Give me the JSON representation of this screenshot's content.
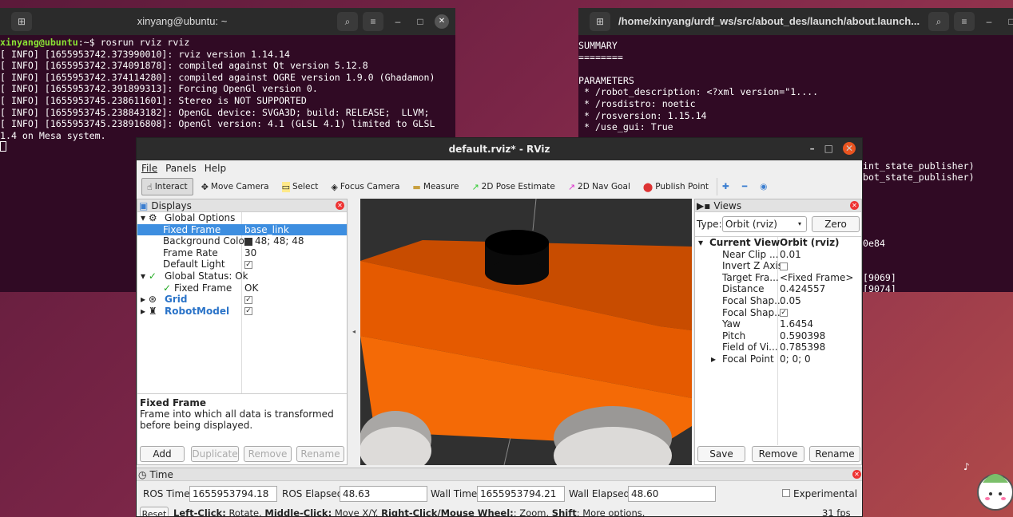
{
  "term1": {
    "title": "xinyang@ubuntu: ~",
    "prompt_user": "xinyang@ubuntu",
    "prompt_rest": ":~$ rosrun rviz rviz",
    "lines": [
      "[ INFO] [1655953742.373990010]: rviz version 1.14.14",
      "[ INFO] [1655953742.374091878]: compiled against Qt version 5.12.8",
      "[ INFO] [1655953742.374114280]: compiled against OGRE version 1.9.0 (Ghadamon)",
      "[ INFO] [1655953742.391899313]: Forcing OpenGl version 0.",
      "[ INFO] [1655953745.238611601]: Stereo is NOT SUPPORTED",
      "[ INFO] [1655953745.238843182]: OpenGL device: SVGA3D; build: RELEASE;  LLVM;",
      "[ INFO] [1655953745.238916808]: OpenGl version: 4.1 (GLSL 4.1) limited to GLSL",
      "1.4 on Mesa system."
    ]
  },
  "term2": {
    "title": "/home/xinyang/urdf_ws/src/about_des/launch/about.launch...",
    "lines": [
      "SUMMARY",
      "========",
      "",
      "PARAMETERS",
      " * /robot_description: <?xml version=\"1....",
      " * /rosdistro: noetic",
      " * /rosversion: 1.15.14",
      " * /use_gui: True"
    ],
    "right_fragments": [
      "int_state_publisher)",
      "bot_state_publisher)",
      "0e84",
      "[9069]",
      "[9074]"
    ]
  },
  "rviz": {
    "title": "default.rviz* - RViz",
    "menu": [
      "File",
      "Panels",
      "Help"
    ],
    "tools": [
      {
        "label": "Interact",
        "icon": "☝"
      },
      {
        "label": "Move Camera",
        "icon": "✥"
      },
      {
        "label": "Select",
        "icon": "▭"
      },
      {
        "label": "Focus Camera",
        "icon": "◈"
      },
      {
        "label": "Measure",
        "icon": "▬"
      },
      {
        "label": "2D Pose Estimate",
        "icon": "↗"
      },
      {
        "label": "2D Nav Goal",
        "icon": "↗"
      },
      {
        "label": "Publish Point",
        "icon": "⬤"
      }
    ],
    "displays": {
      "header": "Displays",
      "global_options": "Global Options",
      "fixed_frame_k": "Fixed Frame",
      "fixed_frame_v": "base_link",
      "bg_k": "Background Color",
      "bg_v": "48; 48; 48",
      "fr_k": "Frame Rate",
      "fr_v": "30",
      "dl_k": "Default Light",
      "gs_k": "Global Status: Ok",
      "ff2_k": "Fixed Frame",
      "ff2_v": "OK",
      "grid": "Grid",
      "robot": "RobotModel",
      "desc_title": "Fixed Frame",
      "desc_text": "Frame into which all data is transformed before being displayed.",
      "buttons": [
        "Add",
        "Duplicate",
        "Remove",
        "Rename"
      ]
    },
    "views": {
      "header": "Views",
      "type_label": "Type:",
      "type_value": "Orbit (rviz)",
      "zero": "Zero",
      "cv_k": "Current View",
      "cv_v": "Orbit (rviz)",
      "props": [
        {
          "k": "Near Clip ...",
          "v": "0.01"
        },
        {
          "k": "Invert Z Axis",
          "v": ""
        },
        {
          "k": "Target Fra...",
          "v": "<Fixed Frame>"
        },
        {
          "k": "Distance",
          "v": "0.424557"
        },
        {
          "k": "Focal Shap...",
          "v": "0.05"
        },
        {
          "k": "Focal Shap...",
          "v": ""
        },
        {
          "k": "Yaw",
          "v": "1.6454"
        },
        {
          "k": "Pitch",
          "v": "0.590398"
        },
        {
          "k": "Field of Vi...",
          "v": "0.785398"
        }
      ],
      "fp_k": "Focal Point",
      "fp_v": "0; 0; 0",
      "buttons": [
        "Save",
        "Remove",
        "Rename"
      ]
    },
    "time": {
      "header": "Time",
      "ros_time_l": "ROS Time:",
      "ros_time": "1655953794.18",
      "ros_el_l": "ROS Elapsed:",
      "ros_el": "48.63",
      "wall_time_l": "Wall Time:",
      "wall_time": "1655953794.21",
      "wall_el_l": "Wall Elapsed:",
      "wall_el": "48.60",
      "experimental": "Experimental"
    },
    "status": {
      "reset": "Reset",
      "lc": "Left-Click:",
      "lc_t": " Rotate. ",
      "mc": "Middle-Click:",
      "mc_t": " Move X/Y. ",
      "rc": "Right-Click/Mouse Wheel:",
      "rc_t": ": Zoom. ",
      "sh": "Shift",
      "sh_t": ": More options.",
      "fps": "31 fps"
    }
  }
}
